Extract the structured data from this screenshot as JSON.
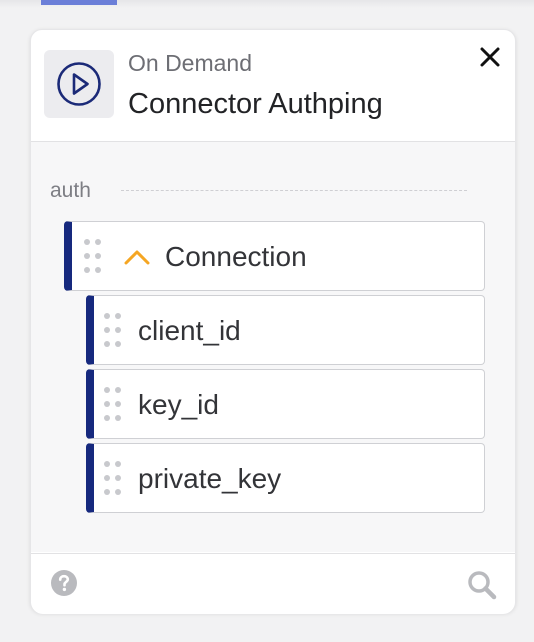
{
  "header": {
    "subtitle": "On Demand",
    "title": "Connector Authping",
    "trigger_icon": "play-circle-icon",
    "close_icon": "close-icon"
  },
  "section": {
    "label": "auth"
  },
  "fields": {
    "parent": {
      "label": "Connection",
      "expanded": true,
      "chevron_icon": "chevron-up-icon"
    },
    "children": [
      {
        "label": "client_id"
      },
      {
        "label": "key_id"
      },
      {
        "label": "private_key"
      }
    ]
  },
  "footer": {
    "help_icon": "question-circle-icon",
    "search_icon": "search-icon"
  },
  "colors": {
    "accent": "#16297e",
    "chevron": "#f5a623",
    "tab_indicator": "#6b7fd8",
    "icon_gray": "#b9babe"
  }
}
